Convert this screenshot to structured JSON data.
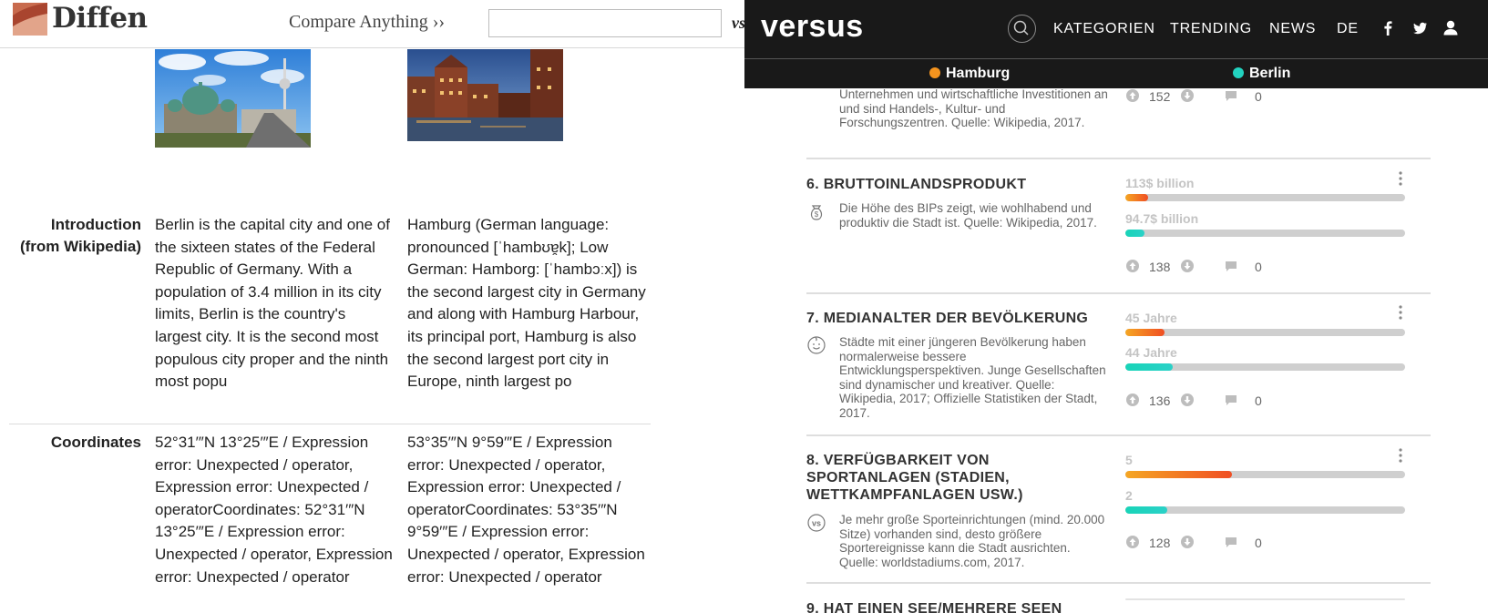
{
  "diffen": {
    "logo_text": "Diffen",
    "compare_label": "Compare Anything ››",
    "search_value": "",
    "vs_text": "vs",
    "rows": {
      "introduction": {
        "label": "Introduction (from Wikipedia)",
        "berlin": "Berlin is the capital city and one of the sixteen states of the Federal Republic of Germany. With a population of 3.4 million in its city limits, Berlin is the country's largest city. It is the second most populous city proper and the ninth most popu",
        "hamburg": "Hamburg (German language: pronounced [ˈhambʊɐ̯k]; Low German: Hamborg: [ˈhambɔːx]) is the second largest city in Germany and along with Hamburg Harbour, its principal port, Hamburg is also the second largest port city in Europe, ninth largest po"
      },
      "coordinates": {
        "label": "Coordinates",
        "berlin": "52°31′″N 13°25′″E / Expression error: Unexpected / operator, Expression error: Unexpected / operatorCoordinates: 52°31′″N 13°25′″E / Expression error: Unexpected / operator, Expression error: Unexpected / operator",
        "hamburg": "53°35′″N 9°59′″E / Expression error: Unexpected / operator, Expression error: Unexpected / operatorCoordinates: 53°35′″N 9°59′″E / Expression error: Unexpected / operator, Expression error: Unexpected / operator"
      }
    }
  },
  "versus": {
    "logo": "versus",
    "nav": [
      "KATEGORIEN",
      "TRENDING",
      "NEWS",
      "DE"
    ],
    "icons": [
      "search-icon",
      "facebook-icon",
      "twitter-icon",
      "user-icon"
    ],
    "colors": {
      "hamburg": "#f5941e",
      "berlin": "#22d3c0",
      "topbar": "#191919"
    },
    "cities": {
      "a": "Hamburg",
      "b": "Berlin"
    },
    "sections": {
      "s5": {
        "desc_fragment": "Unternehmen und wirtschaftliche Investitionen an und sind Handels-, Kultur- und Forschungszentren. Quelle: Wikipedia, 2017.",
        "votes": "152",
        "comments": "0"
      },
      "s6": {
        "title": "6. BRUTTOINLANDSPRODUKT",
        "desc": "Die Höhe des BIPs zeigt, wie wohlhabend und produktiv die Stadt ist. Quelle: Wikipedia, 2017.",
        "value_a": "113$ billion",
        "value_b": "94.7$ billion",
        "fill_a": 0.08,
        "fill_b": 0.07,
        "votes": "138",
        "comments": "0"
      },
      "s7": {
        "title": "7. MEDIANALTER DER BEVÖLKERUNG",
        "desc": "Städte mit einer jüngeren Bevölkerung haben normalerweise bessere Entwicklungsperspektiven. Junge Gesellschaften sind dynamischer und kreativer. Quelle: Wikipedia, 2017; Offizielle Statistiken der Stadt, 2017.",
        "value_a": "45 Jahre",
        "value_b": "44 Jahre",
        "fill_a": 0.14,
        "fill_b": 0.17,
        "votes": "136",
        "comments": "0"
      },
      "s8": {
        "title": "8. VERFÜGBARKEIT VON SPORTANLAGEN (STADIEN, WETTKAMPFANLAGEN USW.)",
        "desc": "Je mehr große Sporteinrichtungen (mind. 20.000 Sitze) vorhanden sind, desto größere Sportereignisse kann die Stadt ausrichten. Quelle: worldstadiums.com, 2017.",
        "value_a": "5",
        "value_b": "2",
        "fill_a": 0.38,
        "fill_b": 0.15,
        "votes": "128",
        "comments": "0"
      },
      "s9": {
        "title": "9. HAT EINEN SEE/MEHRERE SEEN"
      }
    }
  }
}
